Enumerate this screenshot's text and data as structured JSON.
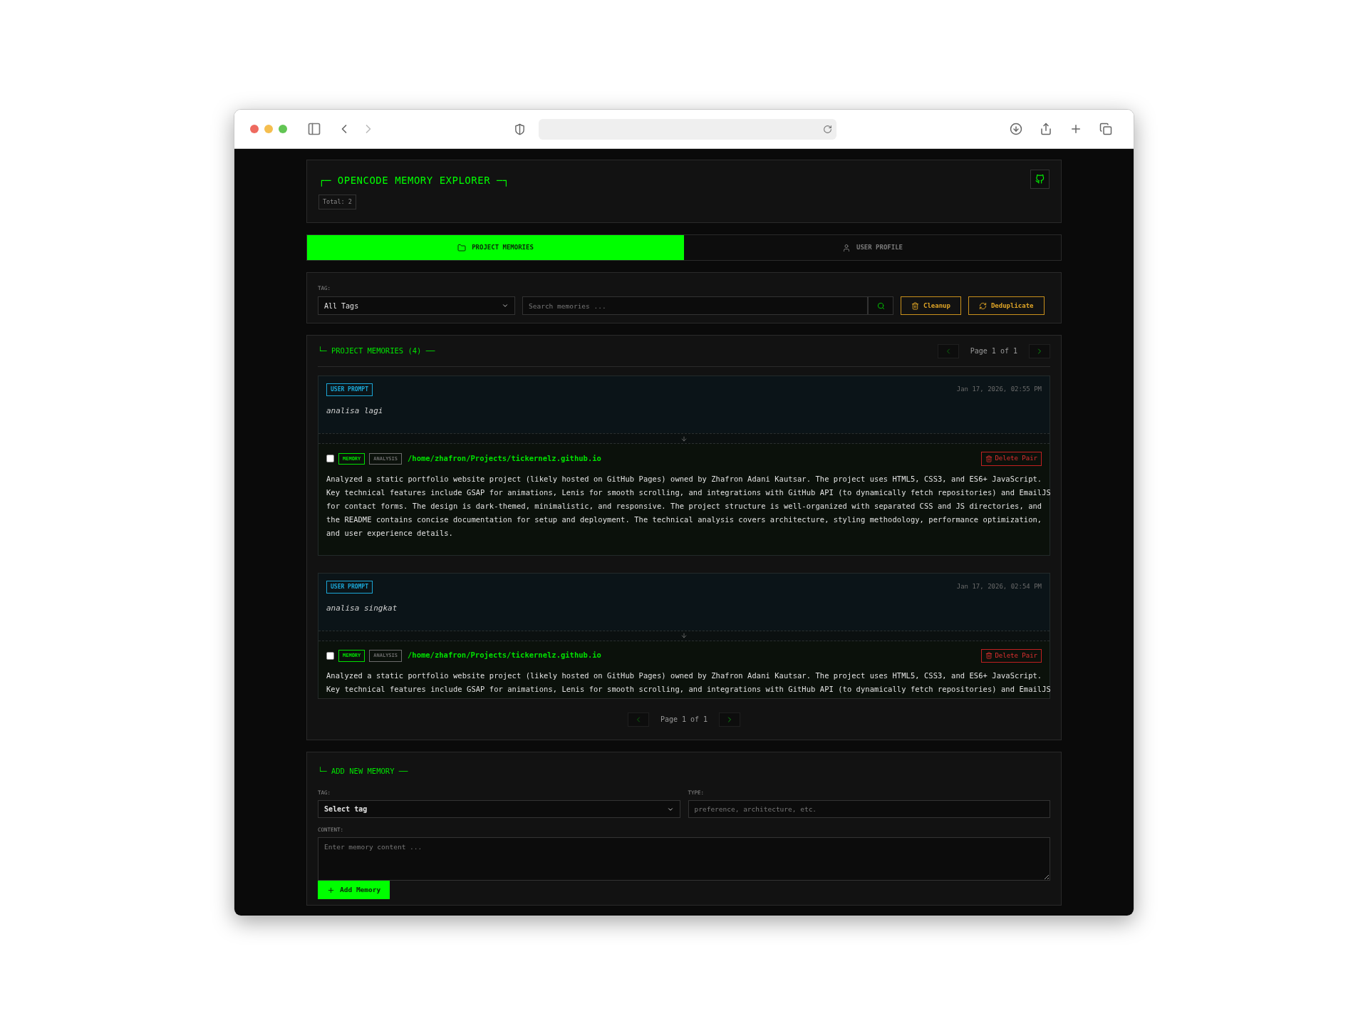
{
  "header": {
    "title": "┌─ OPENCODE MEMORY EXPLORER ─┐",
    "total": "Total: 2"
  },
  "tabs": [
    {
      "label": "PROJECT MEMORIES",
      "kind": "project",
      "selected": true
    },
    {
      "label": "USER PROFILE",
      "kind": "profile",
      "selected": false
    }
  ],
  "filters": {
    "tag_label": "TAG:",
    "tag_value": "All Tags",
    "search_placeholder": "Search memories ...",
    "actions": [
      {
        "label": "Cleanup",
        "kind": "cleanup"
      },
      {
        "label": "Deduplicate",
        "kind": "deduplicate"
      }
    ]
  },
  "list": {
    "title": "└─ PROJECT MEMORIES (4) ──",
    "pager_top": "Page 1 of 1",
    "pairs": [
      {
        "badge": "USER PROMPT",
        "date": "Jan 17, 2026, 02:55 PM",
        "prompt": "analisa lagi",
        "checked": false,
        "tags": [
          {
            "label": "MEMORY",
            "color": "#00e000"
          },
          {
            "label": "ANALYSIS",
            "color": "#6b6b6b"
          }
        ],
        "path": "/home/zhafron/Projects/tickernelz.github.io",
        "delete": "Delete Pair",
        "content": "Analyzed a static portfolio website project (likely hosted on GitHub Pages) owned by Zhafron Adani Kautsar. The project uses HTML5, CSS3, and ES6+ JavaScript. Key technical features include GSAP for animations, Lenis for smooth scrolling, and integrations with GitHub API (to dynamically fetch repositories) and EmailJS for contact forms. The design is dark-themed, minimalistic, and responsive. The project structure is well-organized with separated CSS and JS directories, and the README contains concise documentation for setup and deployment. The technical analysis covers architecture, styling methodology, performance optimization, and user experience details."
      },
      {
        "badge": "USER PROMPT",
        "date": "Jan 17, 2026, 02:54 PM",
        "prompt": "analisa singkat",
        "checked": false,
        "tags": [
          {
            "label": "MEMORY",
            "color": "#00e000"
          },
          {
            "label": "ANALYSIS",
            "color": "#6b6b6b"
          }
        ],
        "path": "/home/zhafron/Projects/tickernelz.github.io",
        "delete": "Delete Pair",
        "content": "Analyzed a static portfolio website project (likely hosted on GitHub Pages) owned by Zhafron Adani Kautsar. The project uses HTML5, CSS3, and ES6+ JavaScript. Key technical features include GSAP for animations, Lenis for smooth scrolling, and integrations with GitHub API (to dynamically fetch repositories) and EmailJS"
      }
    ],
    "pager_bottom": "Page 1 of 1"
  },
  "add": {
    "title": "└─ ADD NEW MEMORY ──",
    "tag_label": "TAG:",
    "tag_value": "Select tag",
    "type_label": "TYPE:",
    "type_placeholder": "preference, architecture, etc.",
    "content_label": "CONTENT:",
    "content_placeholder": "Enter memory content ...",
    "button": "Add Memory"
  }
}
